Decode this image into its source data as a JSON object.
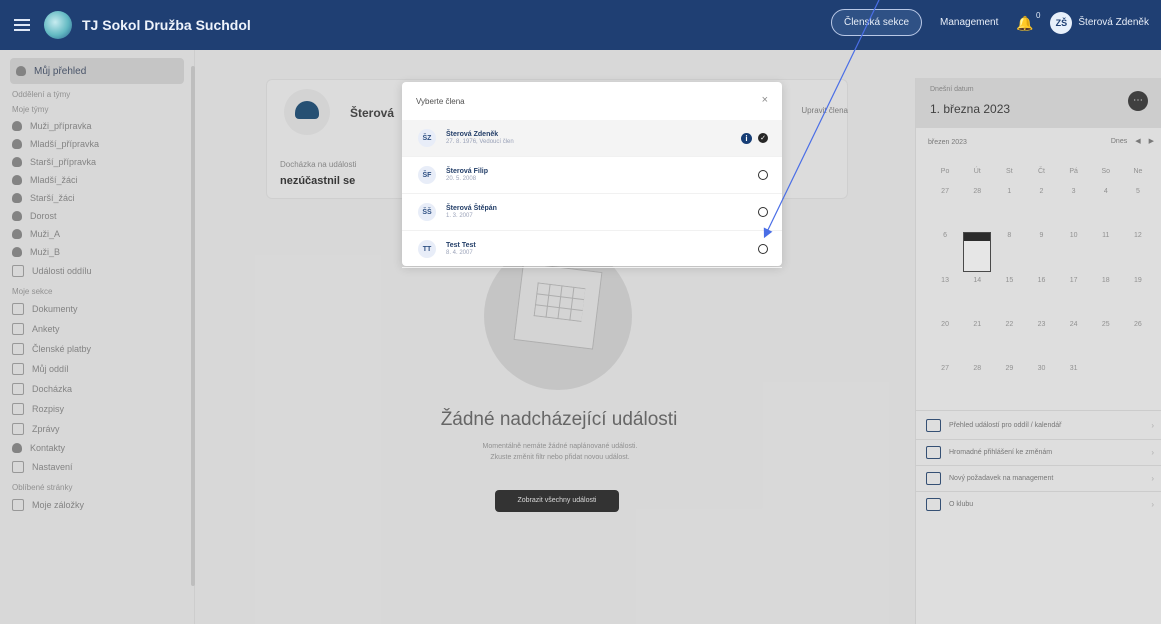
{
  "topbar": {
    "app_title": "TJ Sokol Družba Suchdol",
    "pill_label": "Členská sekce",
    "management_label": "Management",
    "notification_badge": "0",
    "user_initials": "ZŠ",
    "user_name": "Šterová Zdeněk"
  },
  "sidebar": {
    "home_label": "Můj přehled",
    "section_1": "Oddělení a týmy",
    "section_2": "Moje týmy",
    "items_group_1": [
      "Muži_přípravka",
      "Mladší_přípravka",
      "Starší_přípravka",
      "Mladší_žáci",
      "Starší_žáci",
      "Dorost",
      "Muži_A",
      "Muži_B",
      "Události oddílu"
    ],
    "section_3": "Moje sekce",
    "items_group_2": [
      "Dokumenty",
      "Ankety",
      "Členské platby",
      "Můj oddíl",
      "Docházka",
      "Rozpisy",
      "Zprávy",
      "Kontakty",
      "Nastavení"
    ],
    "section_4": "Oblíbené stránky",
    "items_group_3": [
      "Moje záložky"
    ]
  },
  "main": {
    "member_name": "Šterová",
    "right_link": "Upravit člena",
    "subtext": "Docházka na události",
    "subvalue": "nezúčastnil se",
    "empty_title": "Žádné nadcházející události",
    "empty_desc_line1": "Momentálně nemáte žádné naplánované události.",
    "empty_desc_line2": "Zkuste změnit filtr nebo přidat novou událost.",
    "cta_label": "Zobrazit všechny události"
  },
  "calendar": {
    "small_label": "Dnešní datum",
    "date_big": "1. března 2023",
    "month_label": "březen 2023",
    "nav_label": "Dnes",
    "weekdays": [
      "Po",
      "Út",
      "St",
      "Čt",
      "Pá",
      "So",
      "Ne"
    ],
    "days": [
      "27",
      "28",
      "1",
      "2",
      "3",
      "4",
      "5",
      "6",
      "7",
      "8",
      "9",
      "10",
      "11",
      "12",
      "13",
      "14",
      "15",
      "16",
      "17",
      "18",
      "19",
      "20",
      "21",
      "22",
      "23",
      "24",
      "25",
      "26",
      "27",
      "28",
      "29",
      "30",
      "31",
      "",
      "",
      ""
    ]
  },
  "right_links": [
    "Přehled událostí pro oddíl / kalendář",
    "Hromadné přihlášení ke změnám",
    "Nový požadavek na management",
    "O klubu"
  ],
  "modal": {
    "title": "Vyberte člena",
    "close_label": "×",
    "members": [
      {
        "initials": "ŠZ",
        "name": "Šterová Zdeněk",
        "sub": "27. 8. 1976, Vedoucí člen",
        "selected": true
      },
      {
        "initials": "ŠF",
        "name": "Šterová Filip",
        "sub": "20. 5. 2008",
        "selected": false
      },
      {
        "initials": "ŠŠ",
        "name": "Šterová Štěpán",
        "sub": "1. 3. 2007",
        "selected": false
      },
      {
        "initials": "TT",
        "name": "Test Test",
        "sub": "8. 4. 2007",
        "selected": false
      }
    ]
  }
}
